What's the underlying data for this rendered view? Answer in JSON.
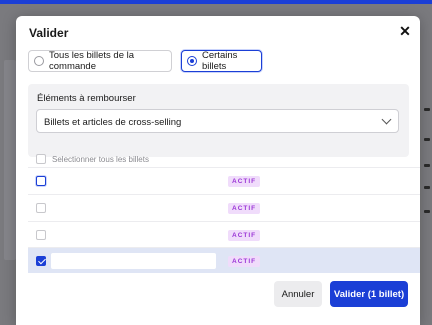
{
  "modal": {
    "title": "Valider",
    "close_icon": "close-icon"
  },
  "scope": {
    "options": [
      {
        "label": "Tous les billets de la commande",
        "selected": false
      },
      {
        "label": "Certains billets",
        "selected": true
      }
    ]
  },
  "refund_items": {
    "label": "Éléments à rembourser",
    "selected_value": "Billets et articles de cross-selling",
    "chevron_icon": "chevron-down-icon"
  },
  "tickets": {
    "select_all_label": "Selectionner tous les billets",
    "rows": [
      {
        "status": "ACTIF",
        "checked": false,
        "focused": true
      },
      {
        "status": "ACTIF",
        "checked": false,
        "focused": false
      },
      {
        "status": "ACTIF",
        "checked": false,
        "focused": false
      },
      {
        "status": "ACTIF",
        "checked": true,
        "focused": false,
        "input_value": ""
      }
    ]
  },
  "footer": {
    "cancel_label": "Annuler",
    "validate_label": "Valider (1 billet)"
  },
  "colors": {
    "accent": "#1b3fd6",
    "badge_bg": "#f0dcfb",
    "badge_text": "#9b35d6",
    "selected_row": "#dfe5f5"
  }
}
